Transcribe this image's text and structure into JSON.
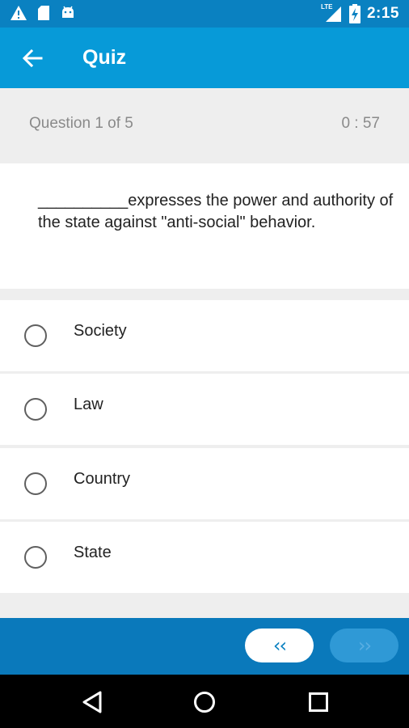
{
  "status_bar": {
    "time": "2:15",
    "network": "LTE",
    "icons": [
      "warning-icon",
      "sd-card-icon",
      "android-icon",
      "signal-icon",
      "battery-charging-icon"
    ]
  },
  "app_bar": {
    "title": "Quiz",
    "back_icon": "arrow-back-icon"
  },
  "quiz": {
    "counter": "Question 1 of  5",
    "timer": "0 : 57",
    "question": "__________expresses the power and authority of the state against \"anti-social\" behavior.",
    "options": [
      {
        "label": "Society"
      },
      {
        "label": "Law"
      },
      {
        "label": "Country"
      },
      {
        "label": "State"
      }
    ]
  },
  "navigation": {
    "prev_label": "‹‹",
    "next_label": "››"
  },
  "colors": {
    "status_bar": "#0a81c1",
    "app_bar": "#079ad8",
    "bottom_bar": "#0a79bb"
  }
}
